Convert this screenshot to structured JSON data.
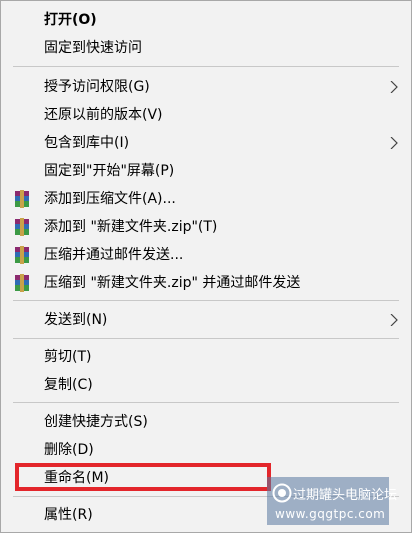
{
  "menu": {
    "items": [
      {
        "label": "打开(O)"
      },
      {
        "label": "固定到快速访问"
      },
      {
        "label": "授予访问权限(G)"
      },
      {
        "label": "还原以前的版本(V)"
      },
      {
        "label": "包含到库中(I)"
      },
      {
        "label": "固定到\"开始\"屏幕(P)"
      },
      {
        "label": "添加到压缩文件(A)...",
        "icon": "winrar-icon"
      },
      {
        "label": "添加到 \"新建文件夹.zip\"(T)",
        "icon": "winrar-icon"
      },
      {
        "label": "压缩并通过邮件发送...",
        "icon": "winrar-icon"
      },
      {
        "label": "压缩到 \"新建文件夹.zip\" 并通过邮件发送",
        "icon": "winrar-icon"
      },
      {
        "label": "发送到(N)"
      },
      {
        "label": "剪切(T)"
      },
      {
        "label": "复制(C)"
      },
      {
        "label": "创建快捷方式(S)"
      },
      {
        "label": "删除(D)"
      },
      {
        "label": "重命名(M)"
      },
      {
        "label": "属性(R)"
      }
    ]
  },
  "watermark": {
    "title": "过期罐头电脑论坛",
    "url": "www.gqgtpc.com"
  },
  "colors": {
    "menu_bg": "#f2f2f2",
    "highlight_border": "#e3262b"
  }
}
